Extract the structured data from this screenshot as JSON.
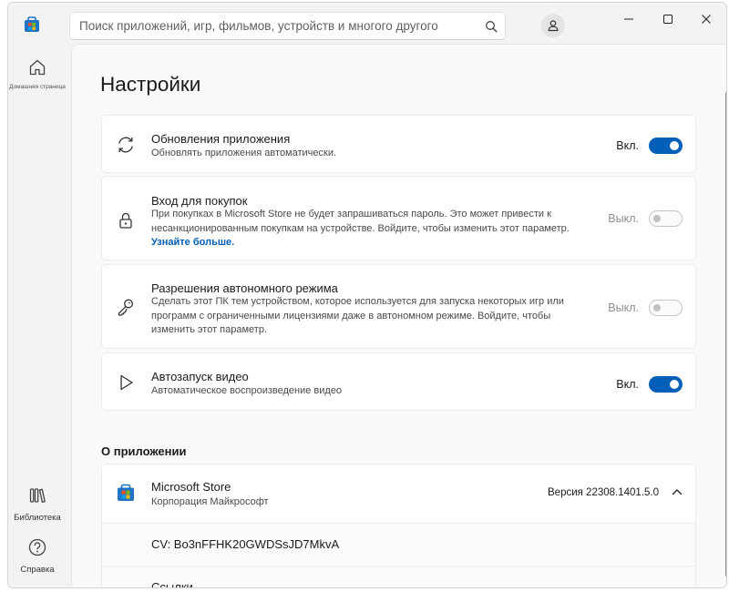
{
  "search": {
    "placeholder": "Поиск приложений, игр, фильмов, устройств и многого другого"
  },
  "nav": {
    "home_label": "Домашняя страница",
    "library_label": "Библиотека",
    "help_label": "Справка"
  },
  "page": {
    "title": "Настройки"
  },
  "settings": [
    {
      "title": "Обновления приложения",
      "desc": "Обновлять приложения автоматически.",
      "state": "Вкл.",
      "toggle": "on",
      "icon": "refresh-icon"
    },
    {
      "title": "Вход для покупок",
      "desc": "При покупках в Microsoft Store не будет запрашиваться пароль. Это может привести к несанкционированным покупкам на устройстве. Войдите, чтобы изменить этот параметр.",
      "link": "Узнайте больше.",
      "state": "Выкл.",
      "toggle": "disabled",
      "icon": "lock-icon"
    },
    {
      "title": "Разрешения автономного режима",
      "desc": "Сделать этот ПК тем устройством, которое используется для запуска некоторых игр или программ с ограниченными лицензиями даже в автономном режиме. Войдите, чтобы изменить этот параметр.",
      "state": "Выкл.",
      "toggle": "disabled",
      "icon": "key-icon"
    },
    {
      "title": "Автозапуск видео",
      "desc": "Автоматическое воспроизведение видео",
      "state": "Вкл.",
      "toggle": "on",
      "icon": "play-icon"
    }
  ],
  "about": {
    "header": "О приложении",
    "app_name": "Microsoft Store",
    "publisher": "Корпорация Майкрософт",
    "version": "Версия 22308.1401.5.0",
    "cv": "CV: Bo3nFFHK20GWDSsJD7MkvA",
    "links_label": "Ссылки"
  },
  "colors": {
    "accent": "#005fb8",
    "window_bg": "#f3f3f3",
    "content_bg": "#f9f9f9"
  }
}
